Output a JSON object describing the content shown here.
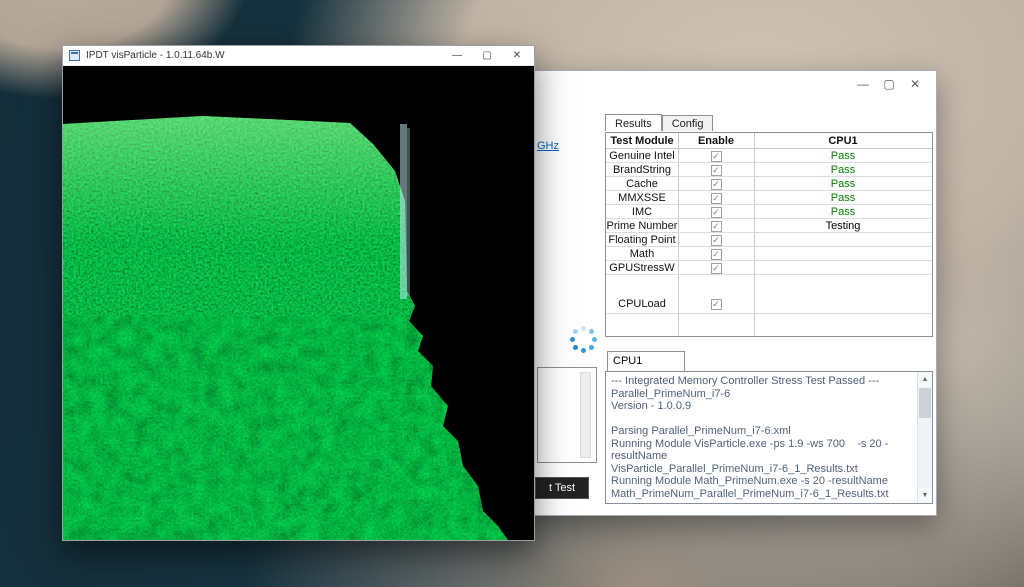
{
  "desktop": {
    "bg_dark": "#16323f",
    "cloud_light": "#cec2b3",
    "cloud_mid": "#a99c8d"
  },
  "front_window": {
    "title": "IPDT visParticle - 1.0.11.64b.W",
    "minimize_glyph": "—",
    "maximize_glyph": "▢",
    "close_glyph": "✕",
    "cube_green": "#27a827"
  },
  "back_window": {
    "minimize_glyph": "—",
    "maximize_glyph": "▢",
    "close_glyph": "✕",
    "ghz_link": "GHz",
    "abort_button_label": "t Test",
    "tabs": [
      "Results",
      "Config"
    ],
    "active_tab": "Results",
    "scroll_up_glyph": "▲",
    "scroll_down_glyph": "▼",
    "table": {
      "headers": [
        "Test Module",
        "Enable",
        "CPU1"
      ],
      "pass_color": "#008000",
      "testing_color": "#000000",
      "rows": [
        {
          "module": "Genuine Intel",
          "enabled": true,
          "status": "Pass"
        },
        {
          "module": "BrandString",
          "enabled": true,
          "status": "Pass"
        },
        {
          "module": "Cache",
          "enabled": true,
          "status": "Pass"
        },
        {
          "module": "MMXSSE",
          "enabled": true,
          "status": "Pass"
        },
        {
          "module": "IMC",
          "enabled": true,
          "status": "Pass"
        },
        {
          "module": "Prime Number",
          "enabled": true,
          "status": "Testing"
        },
        {
          "module": "Floating Point",
          "enabled": true,
          "status": ""
        },
        {
          "module": "Math",
          "enabled": true,
          "status": ""
        },
        {
          "module": "GPUStressW",
          "enabled": true,
          "status": ""
        },
        {
          "module": "CPULoad",
          "enabled": true,
          "status": "",
          "spacer_before": true,
          "tall": true
        }
      ]
    },
    "cpu_group": {
      "label": "CPU1",
      "log_lines": [
        "--- Integrated Memory Controller Stress Test Passed ---",
        "Parallel_PrimeNum_i7-6",
        "Version - 1.0.0.9",
        "",
        "Parsing Parallel_PrimeNum_i7-6.xml",
        "Running Module VisParticle.exe -ps 1.9 -ws 700    -s 20 -resultName",
        "VisParticle_Parallel_PrimeNum_i7-6_1_Results.txt",
        "Running Module Math_PrimeNum.exe -s 20 -resultName",
        "Math_PrimeNum_Parallel_PrimeNum_i7-6_1_Results.txt"
      ]
    }
  }
}
